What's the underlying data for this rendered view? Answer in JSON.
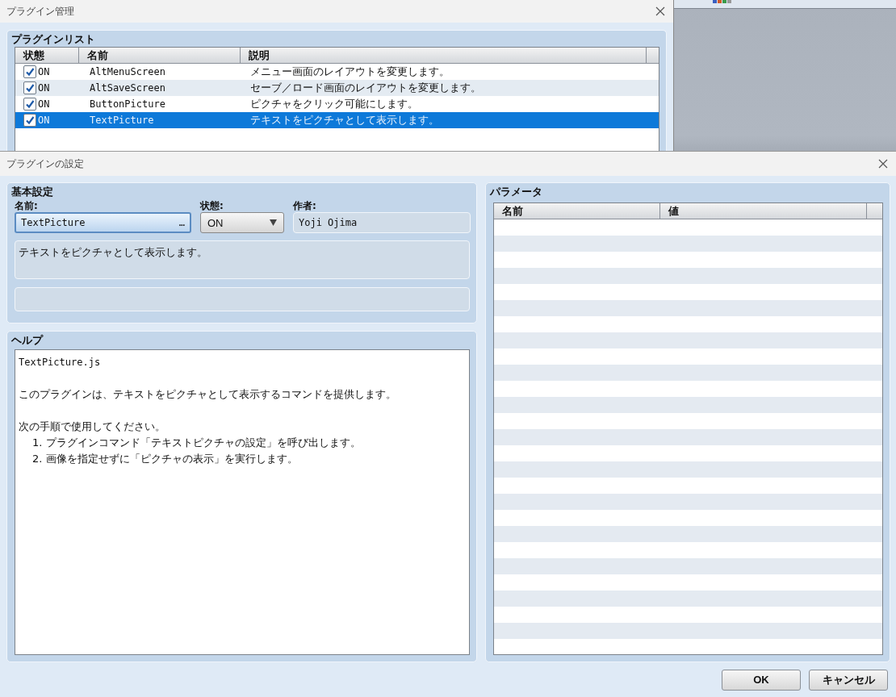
{
  "plugin_manager": {
    "title": "プラグイン管理",
    "list_panel": {
      "title": "プラグインリスト",
      "columns": [
        "状態",
        "名前",
        "説明"
      ],
      "rows": [
        {
          "enabled": true,
          "status": "ON",
          "name": "AltMenuScreen",
          "description": "メニュー画面のレイアウトを変更します。",
          "selected": false
        },
        {
          "enabled": true,
          "status": "ON",
          "name": "AltSaveScreen",
          "description": "セーブ／ロード画面のレイアウトを変更します。",
          "selected": false
        },
        {
          "enabled": true,
          "status": "ON",
          "name": "ButtonPicture",
          "description": "ピクチャをクリック可能にします。",
          "selected": false
        },
        {
          "enabled": true,
          "status": "ON",
          "name": "TextPicture",
          "description": "テキストをピクチャとして表示します。",
          "selected": true
        }
      ]
    }
  },
  "plugin_settings": {
    "title": "プラグインの設定",
    "basic": {
      "title": "基本設定",
      "name_label": "名前:",
      "name_value": "TextPicture",
      "name_button": "…",
      "status_label": "状態:",
      "status_value": "ON",
      "author_label": "作者:",
      "author_value": "Yoji Ojima",
      "description": "テキストをピクチャとして表示します。"
    },
    "help": {
      "title": "ヘルプ",
      "lines": [
        {
          "kind": "text",
          "text": "TextPicture.js"
        },
        {
          "kind": "blank"
        },
        {
          "kind": "text",
          "text": "このプラグインは、テキストをピクチャとして表示するコマンドを提供します。"
        },
        {
          "kind": "blank"
        },
        {
          "kind": "text",
          "text": "次の手順で使用してください。"
        },
        {
          "kind": "step",
          "text": "1. プラグインコマンド「テキストピクチャの設定」を呼び出します。"
        },
        {
          "kind": "step",
          "text": "2. 画像を指定せずに「ピクチャの表示」を実行します。"
        }
      ]
    },
    "parameters": {
      "title": "パラメータ",
      "columns": [
        "名前",
        "値"
      ]
    },
    "buttons": [
      "OK",
      "キャンセル"
    ]
  }
}
